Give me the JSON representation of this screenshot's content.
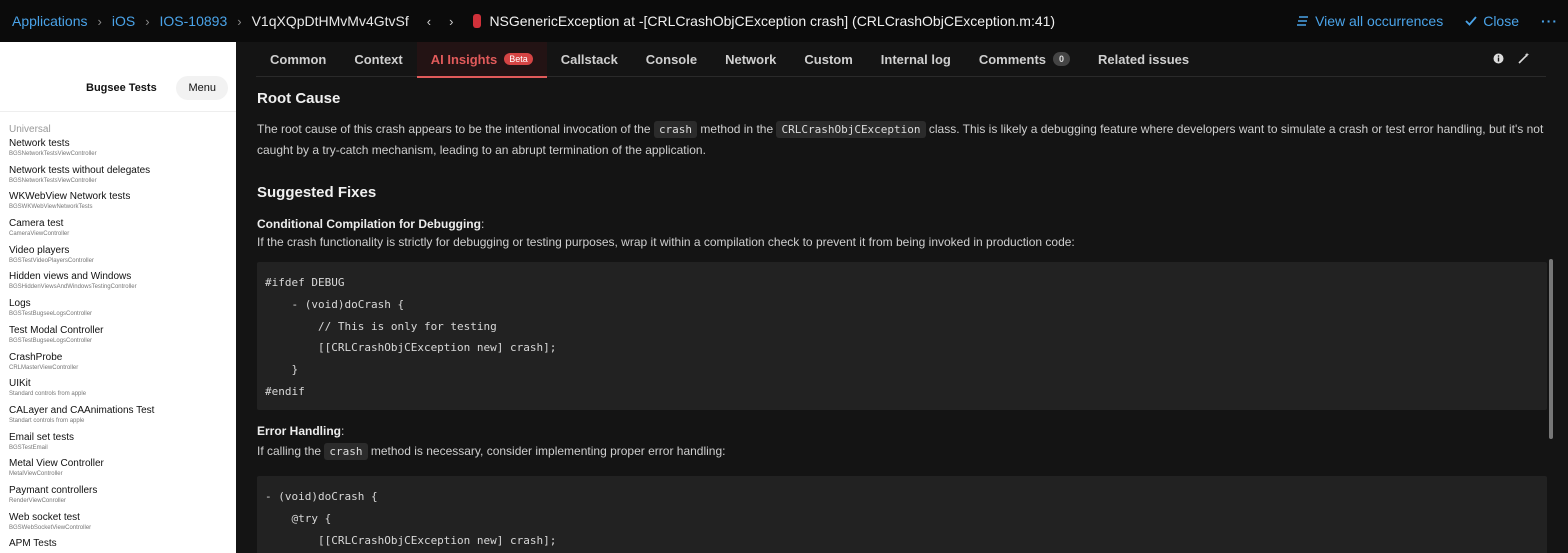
{
  "breadcrumb": {
    "items": [
      "Applications",
      "iOS",
      "IOS-10893"
    ],
    "session_id": "V1qXQpDtHMvMv4GtvSf",
    "prev": "‹",
    "next": "›",
    "exception_title": "NSGenericException at -[CRLCrashObjCException crash] (CRLCrashObjCException.m:41)"
  },
  "top_actions": {
    "view_all": "View all occurrences",
    "close": "Close",
    "more": "···"
  },
  "device": {
    "title": "Bugsee Tests",
    "menu": "Menu",
    "section": "Universal",
    "rows": [
      {
        "title": "Network tests",
        "sub": "BGSNetworkTestsViewController"
      },
      {
        "title": "Network tests without delegates",
        "sub": "BGSNetworkTestsViewController"
      },
      {
        "title": "WKWebView Network tests",
        "sub": "BGSWKWebViewNetworkTests"
      },
      {
        "title": "Camera test",
        "sub": "CameraViewController"
      },
      {
        "title": "Video players",
        "sub": "BGSTestVideoPlayersController"
      },
      {
        "title": "Hidden views and Windows",
        "sub": "BGSHiddenViewsAndWindowsTestingController"
      },
      {
        "title": "Logs",
        "sub": "BGSTestBugseeLogsController"
      },
      {
        "title": "Test Modal Controller",
        "sub": "BGSTestBugseeLogsController"
      },
      {
        "title": "CrashProbe",
        "sub": "CRLMasterViewController"
      },
      {
        "title": "UIKit",
        "sub": "Standard controls from apple"
      },
      {
        "title": "CALayer and CAAnimations Test",
        "sub": "Standart controls from apple"
      },
      {
        "title": "Email set tests",
        "sub": "BGSTestEmail"
      },
      {
        "title": "Metal View Controller",
        "sub": "MetalViewController"
      },
      {
        "title": "Paymant controllers",
        "sub": "RenderViewConroller"
      },
      {
        "title": "Web socket test",
        "sub": "BGSWebSocketViewController"
      },
      {
        "title": "APM Tests",
        "sub": ""
      }
    ]
  },
  "tabs": [
    {
      "label": "Common"
    },
    {
      "label": "Context"
    },
    {
      "label": "AI Insights",
      "tag": "Beta",
      "active": true
    },
    {
      "label": "Callstack"
    },
    {
      "label": "Console"
    },
    {
      "label": "Network"
    },
    {
      "label": "Custom"
    },
    {
      "label": "Internal log"
    },
    {
      "label": "Comments",
      "count": "0"
    },
    {
      "label": "Related issues"
    }
  ],
  "content": {
    "root_cause_heading": "Root Cause",
    "root_cause": {
      "p1": "The root cause of this crash appears to be the intentional invocation of the",
      "code1": "crash",
      "p2": "method in the",
      "code2": "CRLCrashObjCException",
      "p3": "class. This is likely a debugging feature where developers want to simulate a crash or test error handling, but it's not caught by a try-catch mechanism, leading to an abrupt termination of the application."
    },
    "fixes_heading": "Suggested Fixes",
    "fix1_title": "Conditional Compilation for Debugging",
    "fix1_desc": "If the crash functionality is strictly for debugging or testing purposes, wrap it within a compilation check to prevent it from being invoked in production code:",
    "code_block1": [
      "#ifdef DEBUG",
      "    - (void)doCrash {",
      "        // This is only for testing",
      "        [[CRLCrashObjCException new] crash];",
      "    }",
      "#endif"
    ],
    "fix2_title": "Error Handling",
    "fix2_desc_a": "If calling the",
    "fix2_code": "crash",
    "fix2_desc_b": "method is necessary, consider implementing proper error handling:",
    "code_block2": [
      "- (void)doCrash {",
      "    @try {",
      "        [[CRLCrashObjCException new] crash];"
    ]
  },
  "colors": {
    "link": "#4aa3e8",
    "active_tab": "#e05a5a",
    "exception_icon": "#d0313a"
  }
}
